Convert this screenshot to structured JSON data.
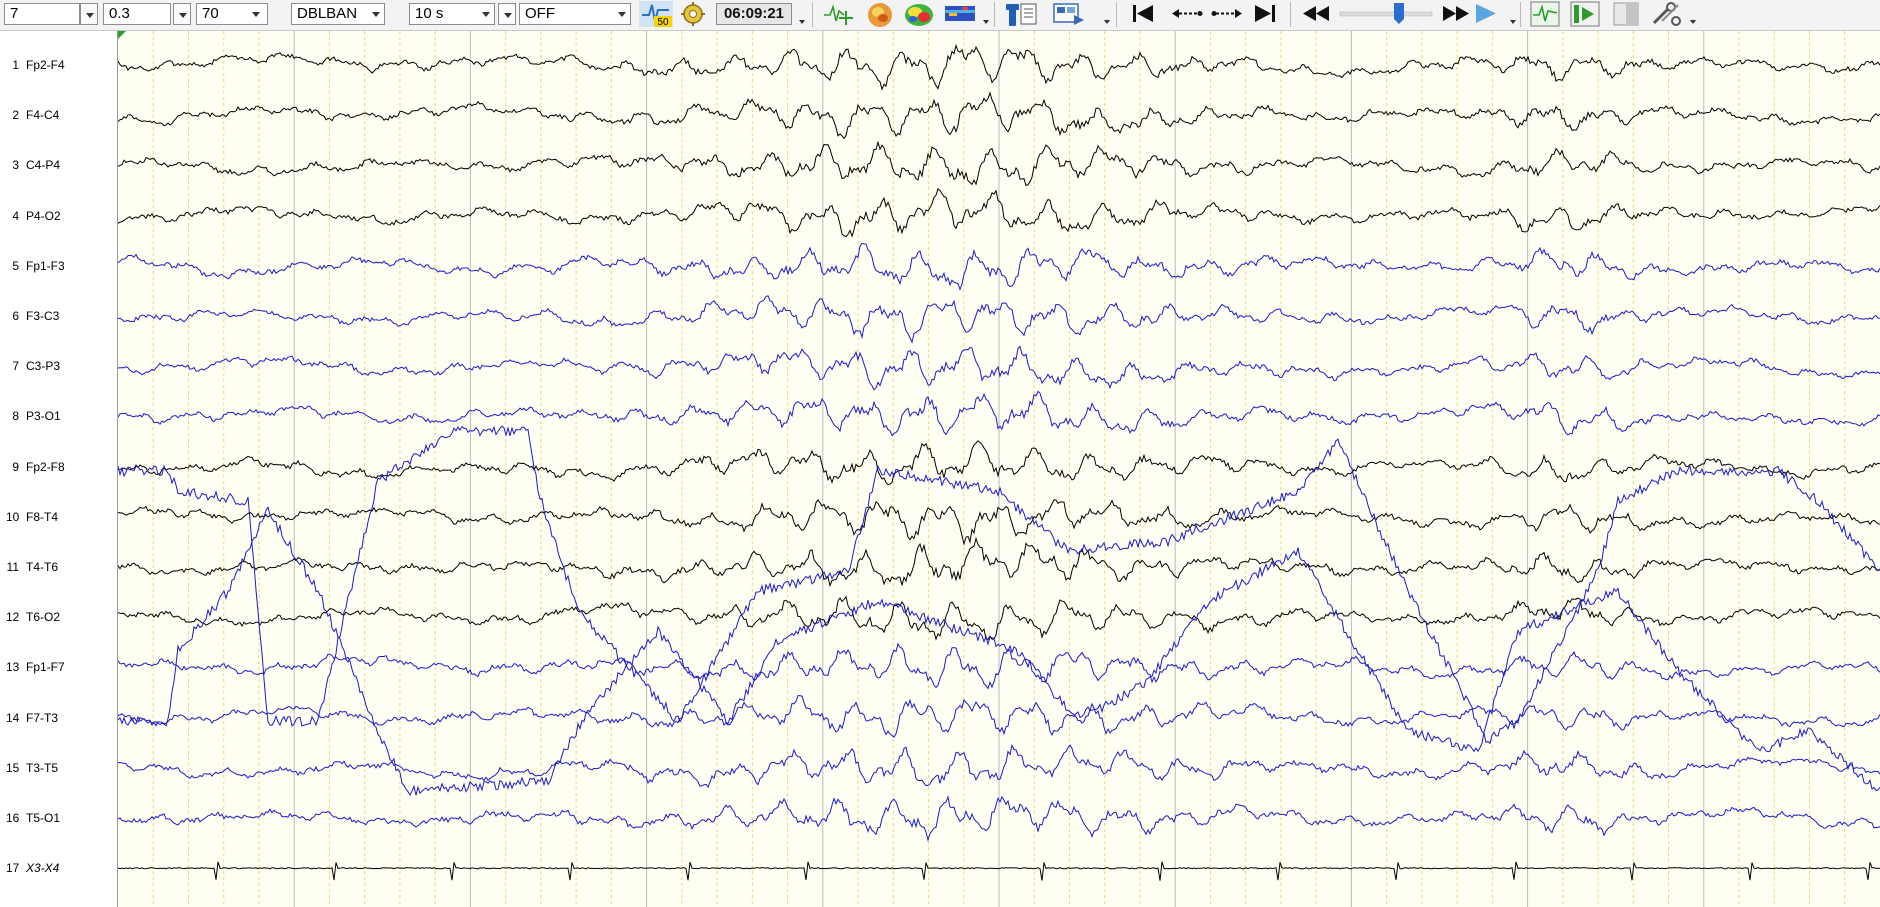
{
  "toolbar": {
    "montage_number": "7",
    "low_filter": "0.3",
    "high_filter": "70",
    "montage_name": "DBLBAN",
    "timebase": "10 s",
    "notch": "OFF",
    "notch_badge": "50",
    "time": "06:09:21"
  },
  "channels": [
    {
      "num": "1",
      "name": "Fp2-F4",
      "color": "#000000"
    },
    {
      "num": "2",
      "name": "F4-C4",
      "color": "#000000"
    },
    {
      "num": "3",
      "name": "C4-P4",
      "color": "#000000"
    },
    {
      "num": "4",
      "name": "P4-O2",
      "color": "#000000"
    },
    {
      "num": "5",
      "name": "Fp1-F3",
      "color": "#1a1acc"
    },
    {
      "num": "6",
      "name": "F3-C3",
      "color": "#1a1acc"
    },
    {
      "num": "7",
      "name": "C3-P3",
      "color": "#1a1acc"
    },
    {
      "num": "8",
      "name": "P3-O1",
      "color": "#1a1acc"
    },
    {
      "num": "9",
      "name": "Fp2-F8",
      "color": "#000000"
    },
    {
      "num": "10",
      "name": "F8-T4",
      "color": "#000000"
    },
    {
      "num": "11",
      "name": "T4-T6",
      "color": "#000000"
    },
    {
      "num": "12",
      "name": "T6-O2",
      "color": "#000000"
    },
    {
      "num": "13",
      "name": "Fp1-F7",
      "color": "#1a1acc"
    },
    {
      "num": "14",
      "name": "F7-T3",
      "color": "#1a1acc"
    },
    {
      "num": "15",
      "name": "T3-T5",
      "color": "#1a1acc"
    },
    {
      "num": "16",
      "name": "T5-O1",
      "color": "#1a1acc"
    },
    {
      "num": "17",
      "name": "X3-X4",
      "color": "#000000",
      "italic": true
    }
  ],
  "colors": {
    "background": "#fffef2",
    "grid_second": "#b9b9b9",
    "grid_sub": "#ecd77a",
    "left_hemisphere": "#1a1acc",
    "right_hemisphere": "#000000"
  },
  "icons": [
    "notch-filter-icon",
    "settings-gear-icon",
    "marker-add-icon",
    "head-map-icon",
    "topo-map-icon",
    "spectrum-icon",
    "montage-editor-icon",
    "video-icon",
    "go-start-icon",
    "step-back-icon",
    "step-forward-icon",
    "go-end-icon",
    "rewind-icon",
    "speed-slider",
    "fast-forward-icon",
    "play-icon",
    "trend-icon",
    "event-next-icon",
    "window-icon",
    "tools-icon"
  ]
}
